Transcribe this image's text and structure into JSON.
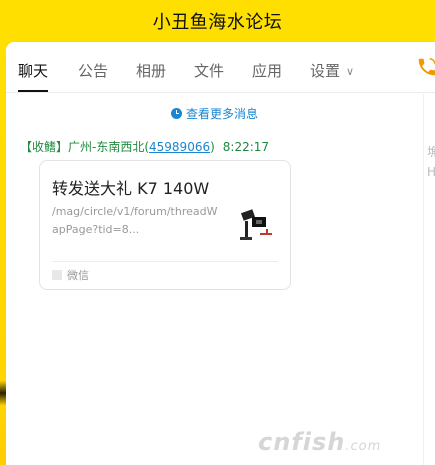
{
  "window": {
    "title": "小丑鱼海水论坛"
  },
  "tabs": [
    {
      "label": "聊天",
      "active": true
    },
    {
      "label": "公告",
      "active": false
    },
    {
      "label": "相册",
      "active": false
    },
    {
      "label": "文件",
      "active": false
    },
    {
      "label": "应用",
      "active": false
    },
    {
      "label": "设置",
      "active": false,
      "has_dropdown": true
    }
  ],
  "dropdown_glyph": "∨",
  "icons": {
    "call": "phone-icon",
    "history": "clock-icon",
    "source": "wechat-icon"
  },
  "chat": {
    "more_messages": "查看更多消息",
    "message": {
      "sender_prefix": "【收鳍】广州-东南西北(",
      "sender_qq": "45989066",
      "sender_suffix": ")",
      "time": "8:22:17",
      "card": {
        "title": "转发送大礼 K7 140W",
        "url": "/mag/circle/v1/forum/threadWapPage?tid=8...",
        "source": "微信"
      }
    }
  },
  "right_panel": {
    "peek_chars": [
      "埆",
      "H"
    ]
  },
  "watermark": {
    "text": "cnfish",
    "suffix": ".com"
  },
  "colors": {
    "title_bar": "#ffdf00",
    "link_blue": "#1a86d0",
    "sender_green": "#1e8a3e",
    "accent_orange": "#f39800"
  }
}
